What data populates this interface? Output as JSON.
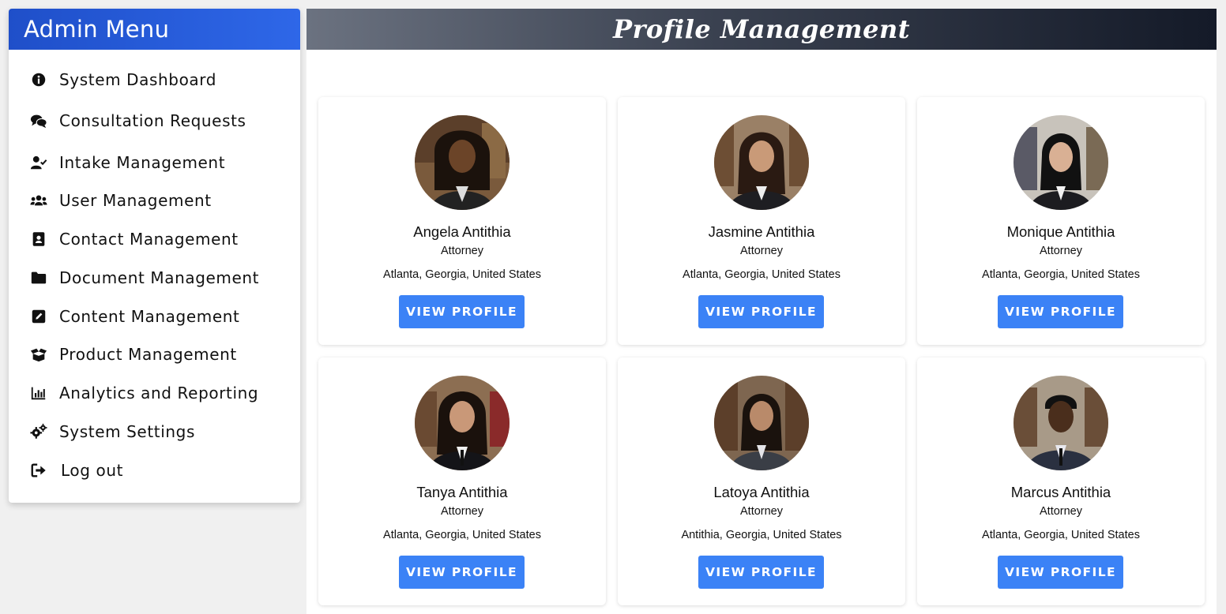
{
  "sidebar": {
    "title": "Admin Menu",
    "items": [
      {
        "label": "System Dashboard",
        "icon": "info-circle-icon"
      },
      {
        "label": "Consultation Requests",
        "icon": "comments-icon"
      },
      {
        "label": "Intake Management",
        "icon": "user-check-icon"
      },
      {
        "label": "User Management",
        "icon": "users-icon"
      },
      {
        "label": "Contact Management",
        "icon": "address-book-icon"
      },
      {
        "label": "Document Management",
        "icon": "folder-icon"
      },
      {
        "label": "Content Management",
        "icon": "edit-icon"
      },
      {
        "label": "Product Management",
        "icon": "box-open-icon"
      },
      {
        "label": "Analytics and Reporting",
        "icon": "chart-bar-icon"
      },
      {
        "label": "System Settings",
        "icon": "cogs-icon"
      },
      {
        "label": "Log out",
        "icon": "sign-out-icon"
      }
    ]
  },
  "main": {
    "title": "Profile Management",
    "button_label": "VIEW PROFILE",
    "profiles": [
      {
        "name": "Angela Antithia",
        "role": "Attorney",
        "location": "Atlanta, Georgia, United States"
      },
      {
        "name": "Jasmine Antithia",
        "role": "Attorney",
        "location": "Atlanta, Georgia, United States"
      },
      {
        "name": "Monique Antithia",
        "role": "Attorney",
        "location": "Atlanta, Georgia, United States"
      },
      {
        "name": "Tanya Antithia",
        "role": "Attorney",
        "location": "Atlanta, Georgia, United States"
      },
      {
        "name": "Latoya Antithia",
        "role": "Attorney",
        "location": "Antithia, Georgia, United States"
      },
      {
        "name": "Marcus Antithia",
        "role": "Attorney",
        "location": "Atlanta, Georgia, United States"
      }
    ]
  },
  "colors": {
    "sidebar_header": "#2559dc",
    "button": "#3b82f6",
    "main_header_dark": "#141a28"
  }
}
